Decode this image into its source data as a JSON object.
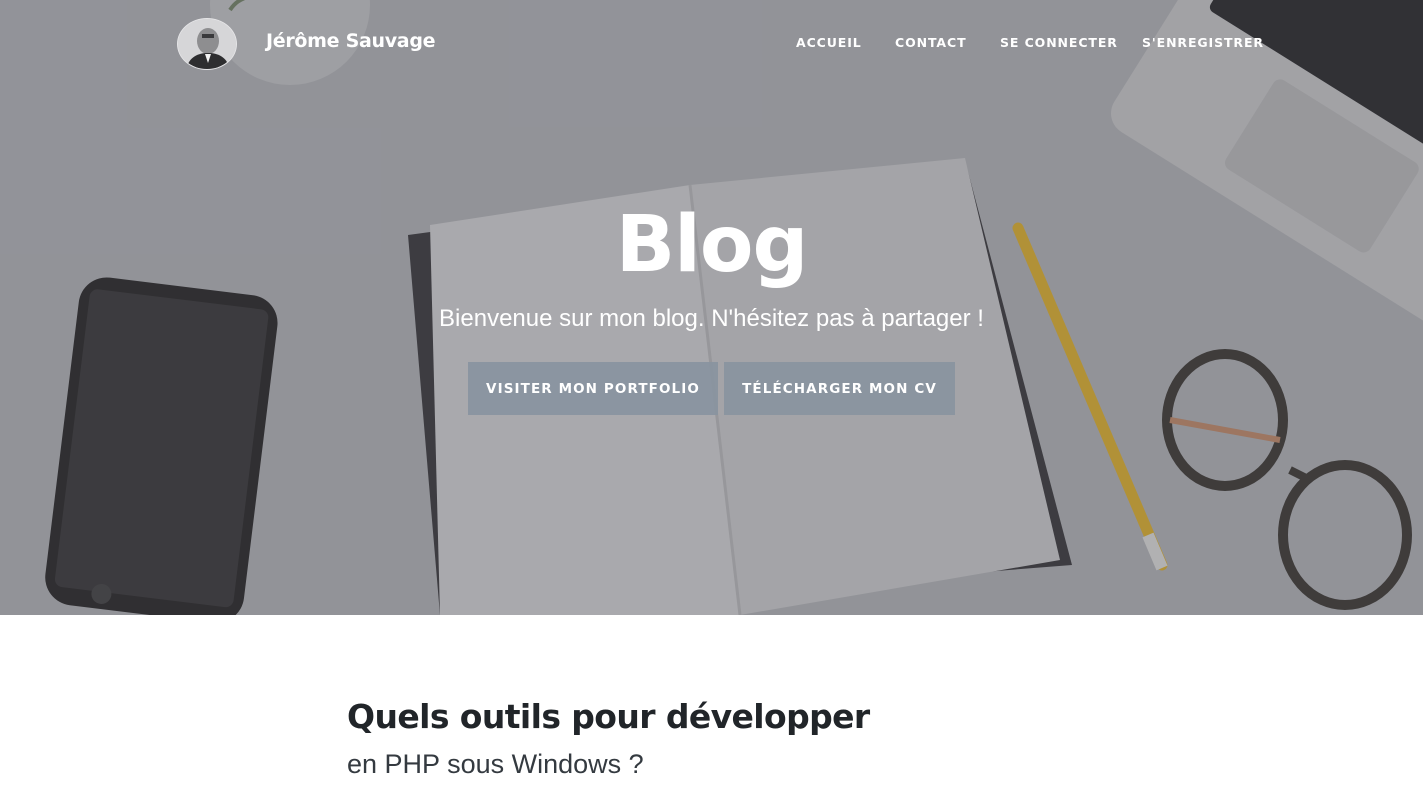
{
  "header": {
    "brand": "Jérôme Sauvage",
    "nav": [
      {
        "label": "ACCUEIL"
      },
      {
        "label": "CONTACT"
      },
      {
        "label": "SE CONNECTER"
      },
      {
        "label": "S'ENREGISTRER"
      }
    ]
  },
  "hero": {
    "title": "Blog",
    "subtitle": "Bienvenue sur mon blog. N'hésitez pas à partager !",
    "buttons": [
      {
        "label": "VISITER MON PORTFOLIO"
      },
      {
        "label": "TÉLÉCHARGER MON CV"
      }
    ]
  },
  "post": {
    "title": "Quels outils pour développer",
    "subtitle": "en PHP sous Windows ?"
  }
}
